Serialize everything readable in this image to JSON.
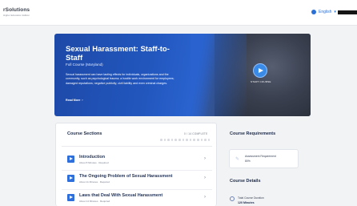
{
  "header": {
    "logo_main": "rSolutions",
    "logo_sub": "Higher Education Edition",
    "language": "English",
    "language_chevron": "▾",
    "globe_icon": "globe-icon"
  },
  "hero": {
    "title": "Sexual Harassment: Staff-to-Staff",
    "subtitle": "Full Course (Maryland)",
    "description": "Sexual harassment can have lasting effects for individuals, organizations and the community, such as psychological trauma; a hostile work environment for employees; damaged reputations; negative publicity; civil liability and even criminal charges.",
    "read_more": "Read More",
    "start_label": "START COURSE"
  },
  "sections": {
    "title": "Course Sections",
    "complete_label": "0 / 14 COMPLETE",
    "progress_total": 14,
    "progress_done": 0,
    "items": [
      {
        "title": "Introduction",
        "meta": "About 8 Minutes · Required"
      },
      {
        "title": "The Ongoing Problem of Sexual Harassment",
        "meta": "About 11 Minutes · Required"
      },
      {
        "title": "Laws that Deal With Sexual Harassment",
        "meta": "About 14 Minutes · Required"
      }
    ]
  },
  "requirements": {
    "title": "Course Requirements",
    "assessment_label": "Assessment Requirement",
    "assessment_value": "80%"
  },
  "details": {
    "title": "Course Details",
    "duration_label": "Total Course Duration",
    "duration_value": "120 Minutes"
  }
}
